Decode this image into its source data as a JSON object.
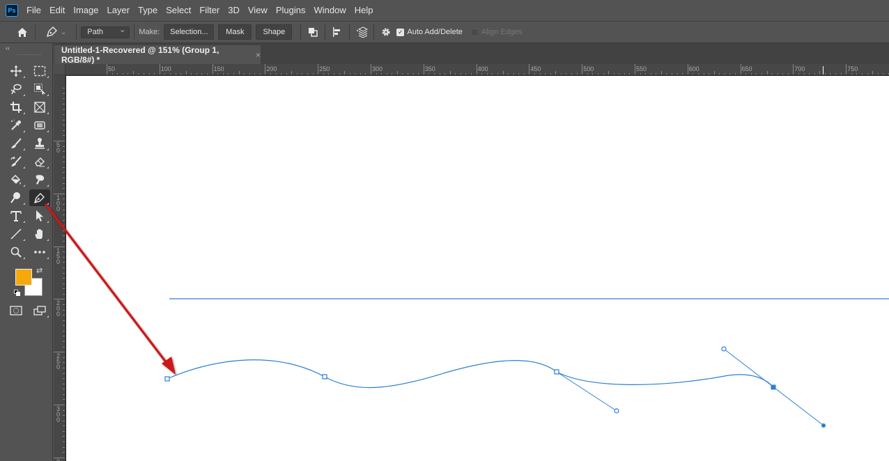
{
  "app": {
    "logo": "Ps"
  },
  "menu": [
    "File",
    "Edit",
    "Image",
    "Layer",
    "Type",
    "Select",
    "Filter",
    "3D",
    "View",
    "Plugins",
    "Window",
    "Help"
  ],
  "options_bar": {
    "home_icon": "home-icon",
    "tool_icon": "pen-icon",
    "mode_select": "Path",
    "make_label": "Make:",
    "selection_button": "Selection...",
    "mask_button": "Mask",
    "shape_button": "Shape",
    "path_ops_icon": "path-operations-icon",
    "path_align_icon": "path-alignment-icon",
    "path_arrange_icon": "path-arrangement-icon",
    "settings_icon": "gear-icon",
    "auto_add_delete": {
      "label": "Auto Add/Delete",
      "checked": true
    },
    "align_edges": {
      "label": "Align Edges",
      "checked": false,
      "disabled": true
    }
  },
  "toolbar": {
    "collapse": "‹‹",
    "tools": [
      {
        "name": "move",
        "glyph": "✥"
      },
      {
        "name": "rectangular-marquee",
        "glyph": "⬚"
      },
      {
        "name": "lasso",
        "glyph": "ᔑ"
      },
      {
        "name": "object-selection",
        "glyph": "⬚"
      },
      {
        "name": "crop",
        "glyph": "⛶"
      },
      {
        "name": "frame",
        "glyph": "⊠"
      },
      {
        "name": "eyedropper",
        "glyph": "✎"
      },
      {
        "name": "spot-healing",
        "glyph": "▦"
      },
      {
        "name": "brush",
        "glyph": "🖌"
      },
      {
        "name": "clone-stamp",
        "glyph": "⚲"
      },
      {
        "name": "history-brush",
        "glyph": "✐"
      },
      {
        "name": "eraser",
        "glyph": "⌫"
      },
      {
        "name": "paint-bucket",
        "glyph": "◈"
      },
      {
        "name": "smudge",
        "glyph": "☚"
      },
      {
        "name": "dodge",
        "glyph": "⚲"
      },
      {
        "name": "pen",
        "glyph": "✒",
        "active": true
      },
      {
        "name": "type",
        "glyph": "T"
      },
      {
        "name": "path-selection",
        "glyph": "➤"
      },
      {
        "name": "line",
        "glyph": "╱"
      },
      {
        "name": "hand",
        "glyph": "✋"
      },
      {
        "name": "zoom",
        "glyph": "🔍"
      },
      {
        "name": "more-tools",
        "glyph": "•••"
      }
    ],
    "foreground_color": "#f5a90c",
    "background_color": "#ffffff"
  },
  "document": {
    "tab_title": "Untitled-1-Recovered @ 151% (Group 1, RGB/8#) *",
    "close_glyph": "×",
    "ruler_h_labels": [
      "50",
      "100",
      "150",
      "200",
      "250",
      "300",
      "350",
      "400",
      "450",
      "500",
      "550",
      "600",
      "650",
      "700",
      "750",
      "8"
    ],
    "ruler_v_labels": [
      "5 0",
      "1 0 0",
      "1 5 0",
      "2 0 0",
      "2 5 0",
      "3 0 0",
      "3 5 0"
    ]
  },
  "colors": {
    "path_blue": "#2a7fd4",
    "arrow_red": "#d01818"
  }
}
